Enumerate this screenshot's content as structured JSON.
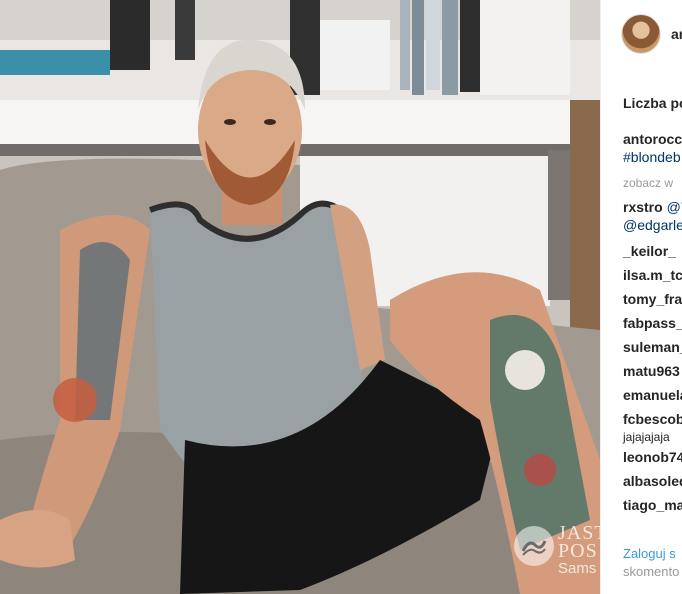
{
  "post": {
    "username": "an",
    "likes_label": "Liczba po",
    "caption": {
      "username": "antorocc",
      "hashtag": "#blondeb"
    },
    "see_more": "zobacz w",
    "comments": [
      {
        "username": "rxstro",
        "text": "@7",
        "extra": "@edgarle"
      },
      {
        "username": "_keilor_",
        "text": ""
      },
      {
        "username": "ilsa.m_tc",
        "text": ""
      },
      {
        "username": "tomy_fra",
        "text": ""
      },
      {
        "username": "fabpass_",
        "text": ""
      },
      {
        "username": "suleman_",
        "text": ""
      },
      {
        "username": "matu963",
        "text": ""
      },
      {
        "username": "emanuela",
        "text": ""
      },
      {
        "username": "fcbescob",
        "text": "",
        "extra": "jajajajaja"
      },
      {
        "username": "leonob74",
        "text": ""
      },
      {
        "username": "albasoled",
        "text": ""
      },
      {
        "username": "tiago_ma",
        "text": ""
      }
    ],
    "login": {
      "link": "Zaloguj s",
      "rest": "skomento"
    }
  },
  "watermark": {
    "line1": "JAST",
    "line2": "POS",
    "line3": "Sams"
  }
}
